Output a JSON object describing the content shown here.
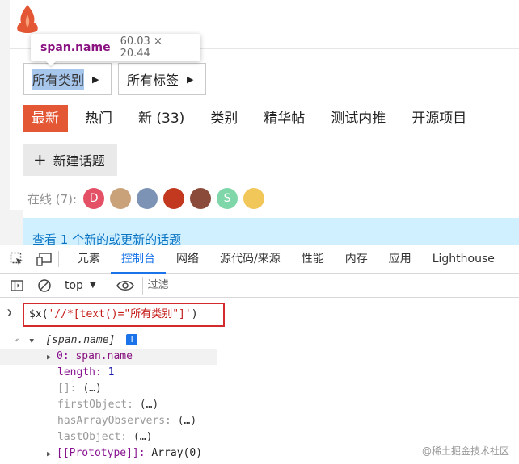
{
  "page": {
    "tooltip": {
      "tag": "span.name",
      "dims": "60.03 × 20.44"
    },
    "filters": [
      {
        "label": "所有类别",
        "caret": "▶"
      },
      {
        "label": "所有标签",
        "caret": "▶"
      }
    ],
    "nav": [
      "最新",
      "热门",
      "新 (33)",
      "类别",
      "精华帖",
      "测试内推",
      "开源项目"
    ],
    "new_topic": {
      "icon": "+",
      "label": "新建话题"
    },
    "online_label": "在线 (7):",
    "avatars": [
      {
        "letter": "D",
        "color": "#e45065"
      },
      {
        "letter": "",
        "color": "#c9a27a"
      },
      {
        "letter": "",
        "color": "#7c93b6"
      },
      {
        "letter": "",
        "color": "#c2391f"
      },
      {
        "letter": "",
        "color": "#8a4b3a"
      },
      {
        "letter": "S",
        "color": "#7fd6a8"
      },
      {
        "letter": "",
        "color": "#f1c75a"
      }
    ],
    "notice": "查看 1 个新的或更新的话题"
  },
  "devtools": {
    "tabs": [
      "元素",
      "控制台",
      "网络",
      "源代码/来源",
      "性能",
      "内存",
      "应用",
      "Lighthouse"
    ],
    "active_tab": "控制台",
    "context": "top",
    "filter_placeholder": "过滤",
    "command": {
      "prefix": "$x(",
      "arg": "'//*[text()=\"所有类别\"]'",
      "suffix": ")"
    },
    "result_header": "[span.name]",
    "rows": [
      {
        "key": "0:",
        "value": "span.name"
      },
      {
        "key": "length:",
        "value": "1"
      },
      {
        "key": "[]:",
        "value": "(…)"
      },
      {
        "key": "firstObject:",
        "value": "(…)"
      },
      {
        "key": "hasArrayObservers:",
        "value": "(…)"
      },
      {
        "key": "lastObject:",
        "value": "(…)"
      },
      {
        "key": "[[Prototype]]:",
        "value": "Array(0)"
      }
    ]
  },
  "watermark": "@稀土掘金技术社区"
}
